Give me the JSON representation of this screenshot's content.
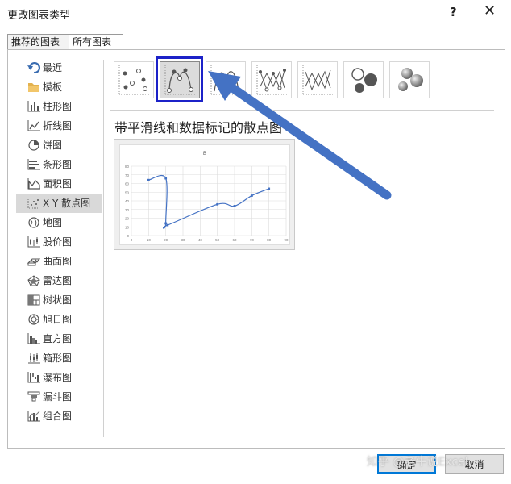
{
  "dialog": {
    "title": "更改图表类型",
    "help_label": "?",
    "close_label": "✕"
  },
  "tabs": [
    {
      "label": "推荐的图表"
    },
    {
      "label": "所有图表"
    }
  ],
  "sidebar": {
    "items": [
      {
        "label": "最近"
      },
      {
        "label": "模板"
      },
      {
        "label": "柱形图"
      },
      {
        "label": "折线图"
      },
      {
        "label": "饼图"
      },
      {
        "label": "条形图"
      },
      {
        "label": "面积图"
      },
      {
        "label": "X Y 散点图"
      },
      {
        "label": "地图"
      },
      {
        "label": "股价图"
      },
      {
        "label": "曲面图"
      },
      {
        "label": "雷达图"
      },
      {
        "label": "树状图"
      },
      {
        "label": "旭日图"
      },
      {
        "label": "直方图"
      },
      {
        "label": "箱形图"
      },
      {
        "label": "瀑布图"
      },
      {
        "label": "漏斗图"
      },
      {
        "label": "组合图"
      }
    ],
    "selected": "X Y 散点图"
  },
  "subtypes": {
    "selected_label": "带平滑线和数据标记的散点图",
    "icons": [
      "scatter-icon",
      "smooth-line-marker-icon",
      "smooth-line-icon",
      "straight-line-marker-icon",
      "straight-line-icon",
      "bubble-icon",
      "bubble-3d-icon"
    ],
    "selected_index": 1
  },
  "preview": {
    "chart_data": {
      "type": "scatter",
      "title": "B",
      "x": [
        10,
        20,
        20,
        21,
        50,
        60,
        70,
        80
      ],
      "y": [
        64,
        66,
        14,
        12,
        36,
        34,
        46,
        54
      ],
      "xlim": [
        0,
        90
      ],
      "ylim": [
        0,
        80
      ],
      "x_ticks": [
        "0",
        "10",
        "20",
        "30",
        "40",
        "50",
        "60",
        "70",
        "80",
        "90"
      ],
      "y_ticks": [
        "0",
        "10",
        "20",
        "30",
        "40",
        "50",
        "60",
        "70",
        "80"
      ],
      "grid": true,
      "smooth": true,
      "line_color": "#4472c4"
    }
  },
  "buttons": {
    "ok": "确定",
    "cancel": "取消"
  },
  "watermark": "知乎 @老牛说Excel",
  "colors": {
    "highlight": "#1c22c8",
    "arrow": "#4472c4",
    "primary_border": "#0078d7"
  }
}
